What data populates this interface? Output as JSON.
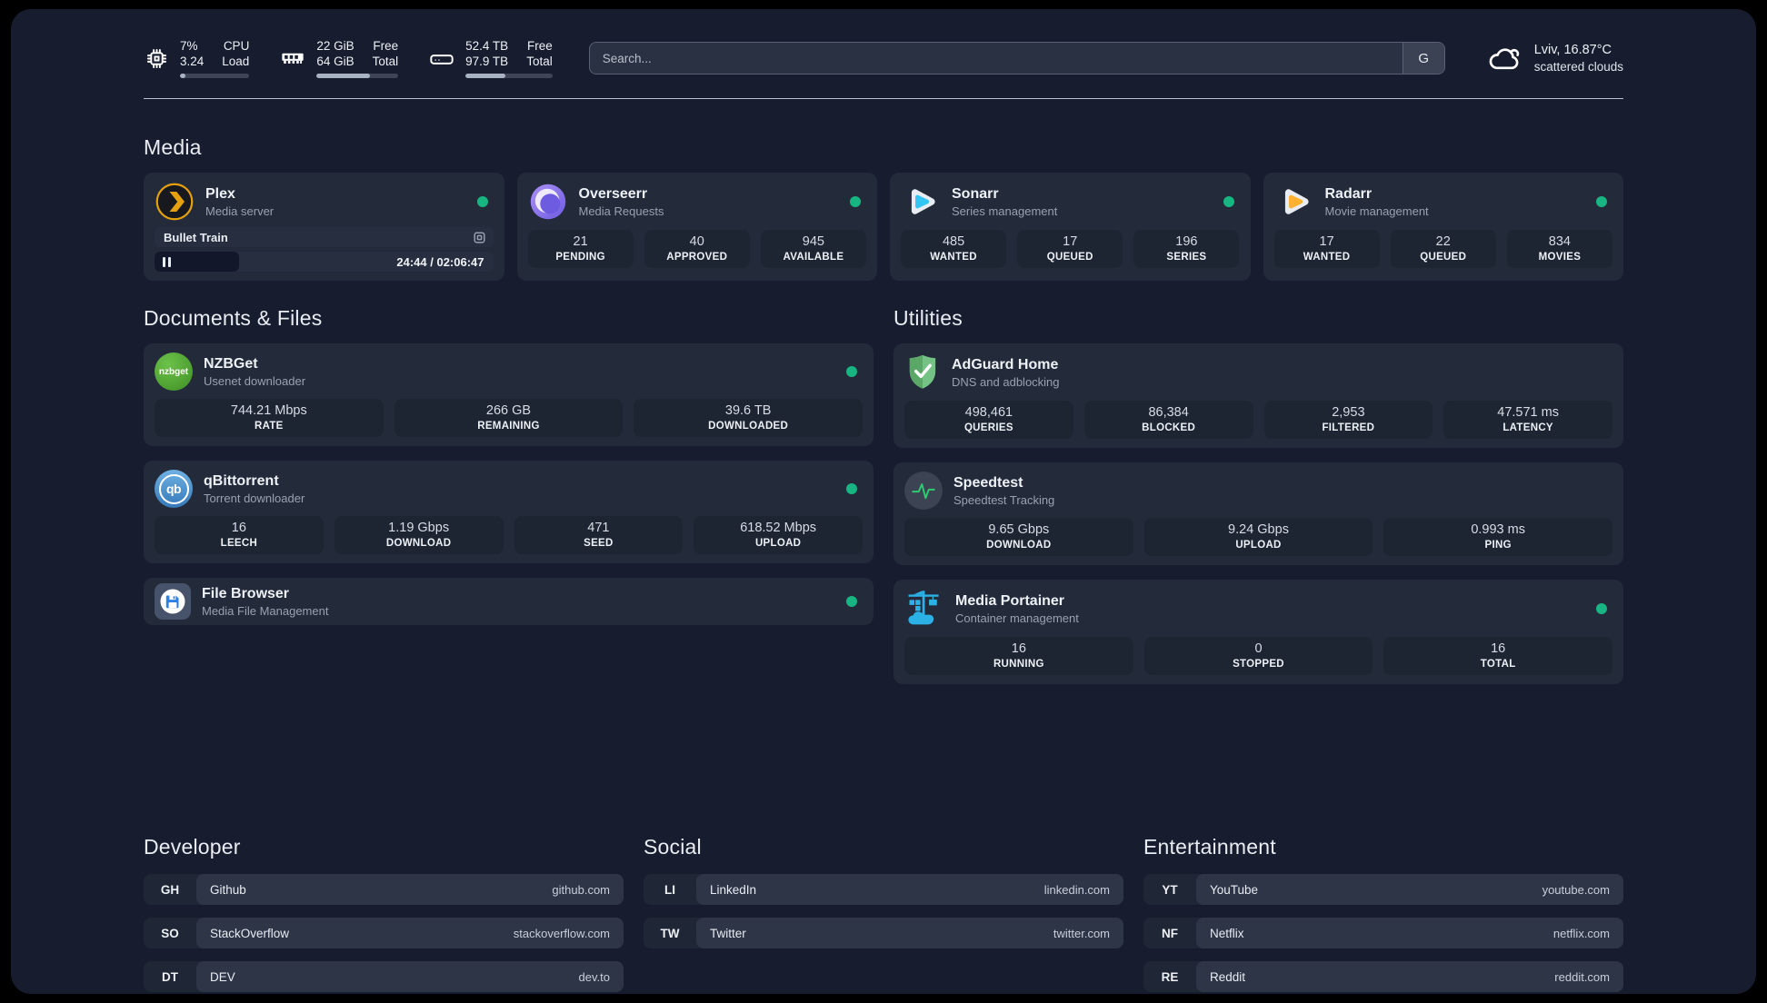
{
  "theme": {
    "page_bg": "#171c2e",
    "card_bg": "#232a3a",
    "tile_bg": "#1d2432",
    "status_online": "#17b582",
    "accent_plex": "#e5a00d",
    "accent_sonarr": "#33c5f4",
    "accent_radarr": "#fcb22f"
  },
  "header": {
    "system": {
      "cpu": {
        "icon": "cpu-icon",
        "line1_value": "7%",
        "line2_value": "3.24",
        "line1_label": "CPU",
        "line2_label": "Load",
        "progress_pct": 8
      },
      "memory": {
        "icon": "ram-icon",
        "line1_value": "22 GiB",
        "line2_value": "64 GiB",
        "line1_label": "Free",
        "line2_label": "Total",
        "progress_pct": 65
      },
      "disk": {
        "icon": "hard-drive-icon",
        "line1_value": "52.4 TB",
        "line2_value": "97.9 TB",
        "line1_label": "Free",
        "line2_label": "Total",
        "progress_pct": 46
      }
    },
    "search": {
      "placeholder": "Search...",
      "engine_button": "G"
    },
    "weather": {
      "icon": "cloud-icon",
      "location": "Lviv, 16.87°C",
      "condition": "scattered clouds"
    }
  },
  "sections": {
    "media": {
      "title": "Media",
      "apps": {
        "plex": {
          "name": "Plex",
          "description": "Media server",
          "icon": "plex-icon",
          "status": "online",
          "player": {
            "title": "Bullet Train",
            "state": "paused",
            "time_display": "24:44 / 02:06:47",
            "elapsed": "24:44",
            "duration": "02:06:47",
            "progress_pct": 25
          }
        },
        "overseerr": {
          "name": "Overseerr",
          "description": "Media Requests",
          "icon": "overseerr-icon",
          "status": "online",
          "stats": [
            {
              "value": "21",
              "label": "PENDING"
            },
            {
              "value": "40",
              "label": "APPROVED"
            },
            {
              "value": "945",
              "label": "AVAILABLE"
            }
          ]
        },
        "sonarr": {
          "name": "Sonarr",
          "description": "Series management",
          "icon": "sonarr-icon",
          "status": "online",
          "stats": [
            {
              "value": "485",
              "label": "WANTED"
            },
            {
              "value": "17",
              "label": "QUEUED"
            },
            {
              "value": "196",
              "label": "SERIES"
            }
          ]
        },
        "radarr": {
          "name": "Radarr",
          "description": "Movie management",
          "icon": "radarr-icon",
          "status": "online",
          "stats": [
            {
              "value": "17",
              "label": "WANTED"
            },
            {
              "value": "22",
              "label": "QUEUED"
            },
            {
              "value": "834",
              "label": "MOVIES"
            }
          ]
        }
      }
    },
    "documents": {
      "title": "Documents & Files",
      "apps": {
        "nzbget": {
          "name": "NZBGet",
          "description": "Usenet downloader",
          "icon": "nzbget-icon",
          "status": "online",
          "stats": [
            {
              "value": "744.21 Mbps",
              "label": "RATE"
            },
            {
              "value": "266 GB",
              "label": "REMAINING"
            },
            {
              "value": "39.6 TB",
              "label": "DOWNLOADED"
            }
          ]
        },
        "qbittorrent": {
          "name": "qBittorrent",
          "description": "Torrent downloader",
          "icon": "qbittorrent-icon",
          "status": "online",
          "stats": [
            {
              "value": "16",
              "label": "LEECH"
            },
            {
              "value": "1.19 Gbps",
              "label": "DOWNLOAD"
            },
            {
              "value": "471",
              "label": "SEED"
            },
            {
              "value": "618.52 Mbps",
              "label": "UPLOAD"
            }
          ]
        },
        "filebrowser": {
          "name": "File Browser",
          "description": "Media File Management",
          "icon": "file-browser-icon",
          "status": "online"
        }
      }
    },
    "utilities": {
      "title": "Utilities",
      "apps": {
        "adguard": {
          "name": "AdGuard Home",
          "description": "DNS and adblocking",
          "icon": "adguard-shield-icon",
          "stats": [
            {
              "value": "498,461",
              "label": "QUERIES"
            },
            {
              "value": "86,384",
              "label": "BLOCKED"
            },
            {
              "value": "2,953",
              "label": "FILTERED"
            },
            {
              "value": "47.571 ms",
              "label": "LATENCY"
            }
          ]
        },
        "speedtest": {
          "name": "Speedtest",
          "description": "Speedtest Tracking",
          "icon": "speedtest-pulse-icon",
          "stats": [
            {
              "value": "9.65 Gbps",
              "label": "DOWNLOAD"
            },
            {
              "value": "9.24 Gbps",
              "label": "UPLOAD"
            },
            {
              "value": "0.993 ms",
              "label": "PING"
            }
          ]
        },
        "portainer": {
          "name": "Media Portainer",
          "description": "Container management",
          "icon": "portainer-crane-icon",
          "status": "online",
          "stats": [
            {
              "value": "16",
              "label": "RUNNING"
            },
            {
              "value": "0",
              "label": "STOPPED"
            },
            {
              "value": "16",
              "label": "TOTAL"
            }
          ]
        }
      }
    },
    "developer": {
      "title": "Developer",
      "links": [
        {
          "abbr": "GH",
          "name": "Github",
          "url": "github.com"
        },
        {
          "abbr": "SO",
          "name": "StackOverflow",
          "url": "stackoverflow.com"
        },
        {
          "abbr": "DT",
          "name": "DEV",
          "url": "dev.to"
        }
      ]
    },
    "social": {
      "title": "Social",
      "links": [
        {
          "abbr": "LI",
          "name": "LinkedIn",
          "url": "linkedin.com"
        },
        {
          "abbr": "TW",
          "name": "Twitter",
          "url": "twitter.com"
        }
      ]
    },
    "entertainment": {
      "title": "Entertainment",
      "links": [
        {
          "abbr": "YT",
          "name": "YouTube",
          "url": "youtube.com"
        },
        {
          "abbr": "NF",
          "name": "Netflix",
          "url": "netflix.com"
        },
        {
          "abbr": "RE",
          "name": "Reddit",
          "url": "reddit.com"
        }
      ]
    }
  }
}
